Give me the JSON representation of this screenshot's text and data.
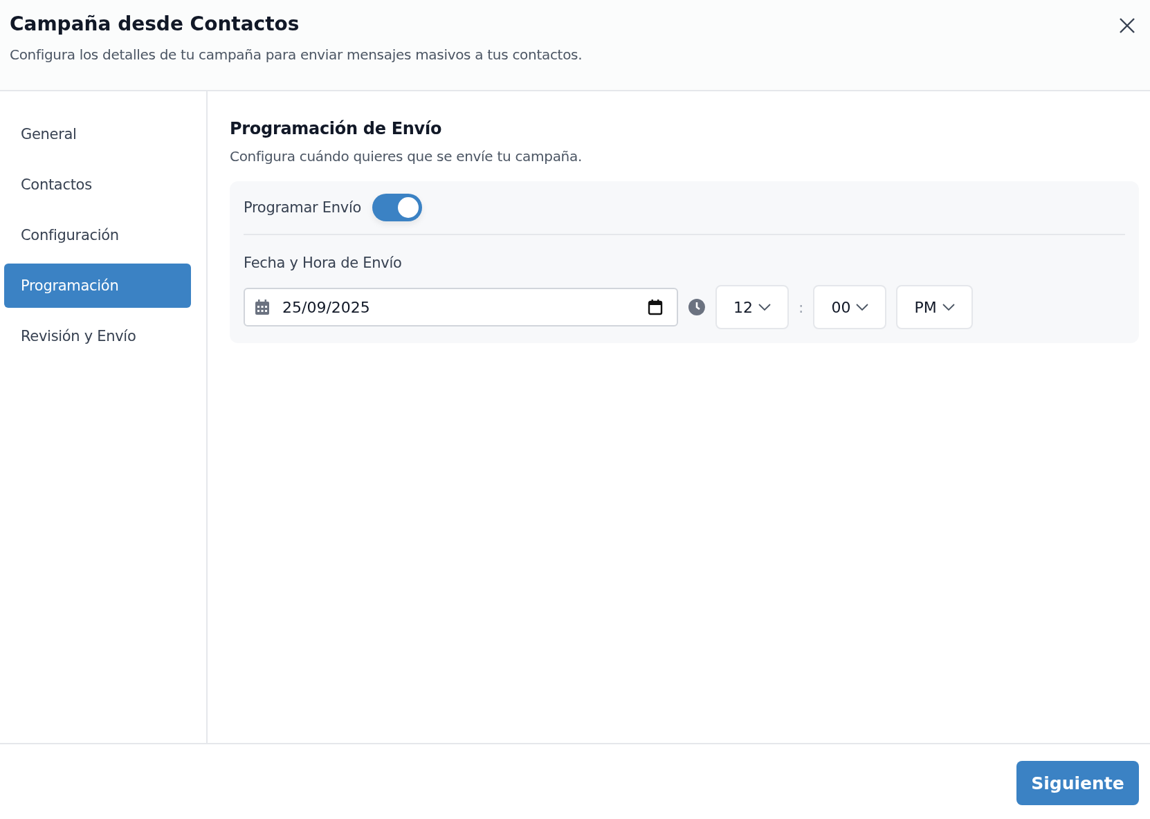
{
  "dialog": {
    "title": "Campaña desde Contactos",
    "subtitle": "Configura los detalles de tu campaña para enviar mensajes masivos a tus contactos."
  },
  "sidebar": {
    "items": [
      {
        "label": "General",
        "selected": false
      },
      {
        "label": "Contactos",
        "selected": false
      },
      {
        "label": "Configuración",
        "selected": false
      },
      {
        "label": "Programación",
        "selected": true
      },
      {
        "label": "Revisión y Envío",
        "selected": false
      }
    ]
  },
  "section": {
    "title": "Programación de Envío",
    "description": "Configura cuándo quieres que se envíe tu campaña."
  },
  "schedule_toggle": {
    "label": "Programar Envío",
    "on": true
  },
  "datetime": {
    "label": "Fecha y Hora de Envío",
    "date": "25/09/2025",
    "hour": "12",
    "separator": ":",
    "minute": "00",
    "period": "PM"
  },
  "footer": {
    "next_button": "Siguiente"
  }
}
